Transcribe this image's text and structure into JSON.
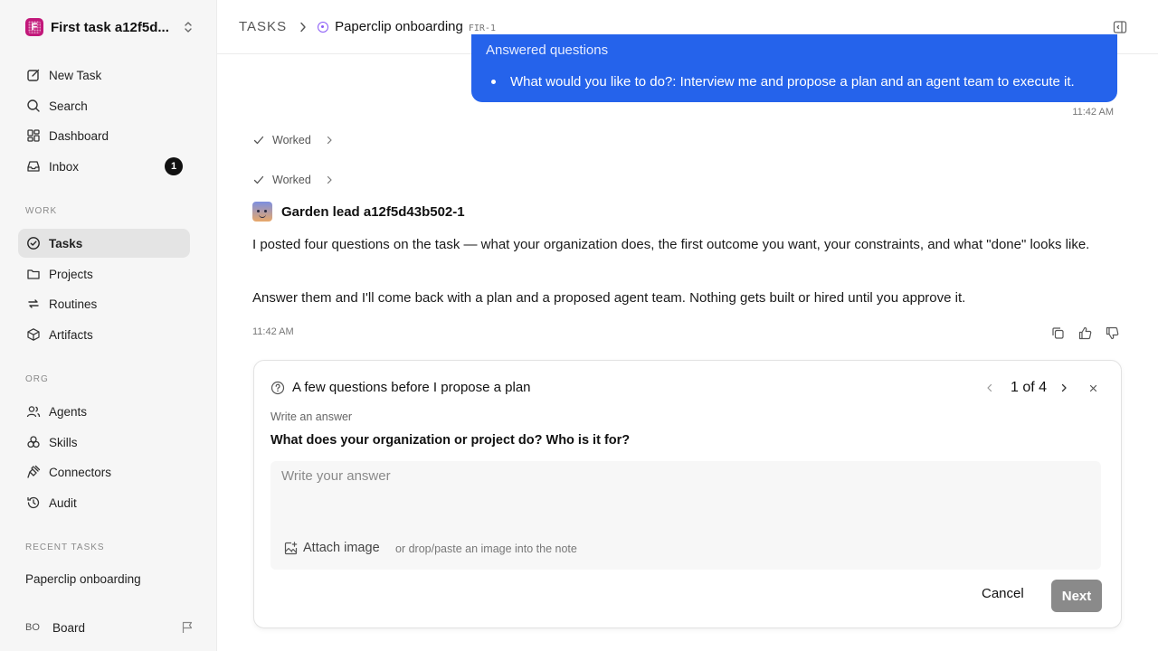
{
  "workspace": {
    "name": "First task a12f5d...",
    "logo_letter": "F",
    "logo_color": "#c2187a"
  },
  "sidebar": {
    "primary": [
      {
        "label": "New Task",
        "icon": "edit-icon"
      },
      {
        "label": "Search",
        "icon": "search-icon"
      },
      {
        "label": "Dashboard",
        "icon": "dashboard-icon"
      },
      {
        "label": "Inbox",
        "icon": "inbox-icon",
        "badge": "1"
      }
    ],
    "work_label": "WORK",
    "work": [
      {
        "label": "Tasks",
        "icon": "check-circle-icon",
        "active": true
      },
      {
        "label": "Projects",
        "icon": "folder-icon"
      },
      {
        "label": "Routines",
        "icon": "repeat-icon"
      },
      {
        "label": "Artifacts",
        "icon": "box-icon"
      }
    ],
    "org_label": "ORG",
    "org": [
      {
        "label": "Agents",
        "icon": "users-icon"
      },
      {
        "label": "Skills",
        "icon": "skills-icon"
      },
      {
        "label": "Connectors",
        "icon": "plug-icon"
      },
      {
        "label": "Audit",
        "icon": "history-icon"
      }
    ],
    "recent_label": "RECENT TASKS",
    "recent": [
      {
        "label": "Paperclip onboarding"
      }
    ],
    "board": {
      "initials": "BO",
      "label": "Board"
    }
  },
  "header": {
    "root": "TASKS",
    "title": "Paperclip onboarding",
    "id": "FIR-1",
    "status_color": "#8b5cf6"
  },
  "thread": {
    "user_bubble": {
      "previous_line": "Answered questions",
      "bullet": "What would you like to do?: Interview me and propose a plan and an agent team to execute it.",
      "time": "11:42 AM",
      "color": "#2563eb"
    },
    "worked": [
      {
        "label": "Worked"
      },
      {
        "label": "Worked"
      }
    ],
    "agent": {
      "name": "Garden lead a12f5d43b502-1",
      "paragraphs": [
        "I posted four questions on the task — what your organization does, the first outcome you want, your constraints, and what \"done\" looks like.",
        "Answer them and I'll come back with a plan and a proposed agent team. Nothing gets built or hired until you approve it."
      ],
      "time": "11:42 AM"
    }
  },
  "question_card": {
    "title": "A few questions before I propose a plan",
    "pager": "1 of 4",
    "hint": "Write an answer",
    "question": "What does your organization or project do? Who is it for?",
    "answer_value": "",
    "answer_placeholder": "Write your answer",
    "attach_label": "Attach image",
    "attach_hint": "or drop/paste an image into the note",
    "cancel_label": "Cancel",
    "next_label": "Next"
  }
}
